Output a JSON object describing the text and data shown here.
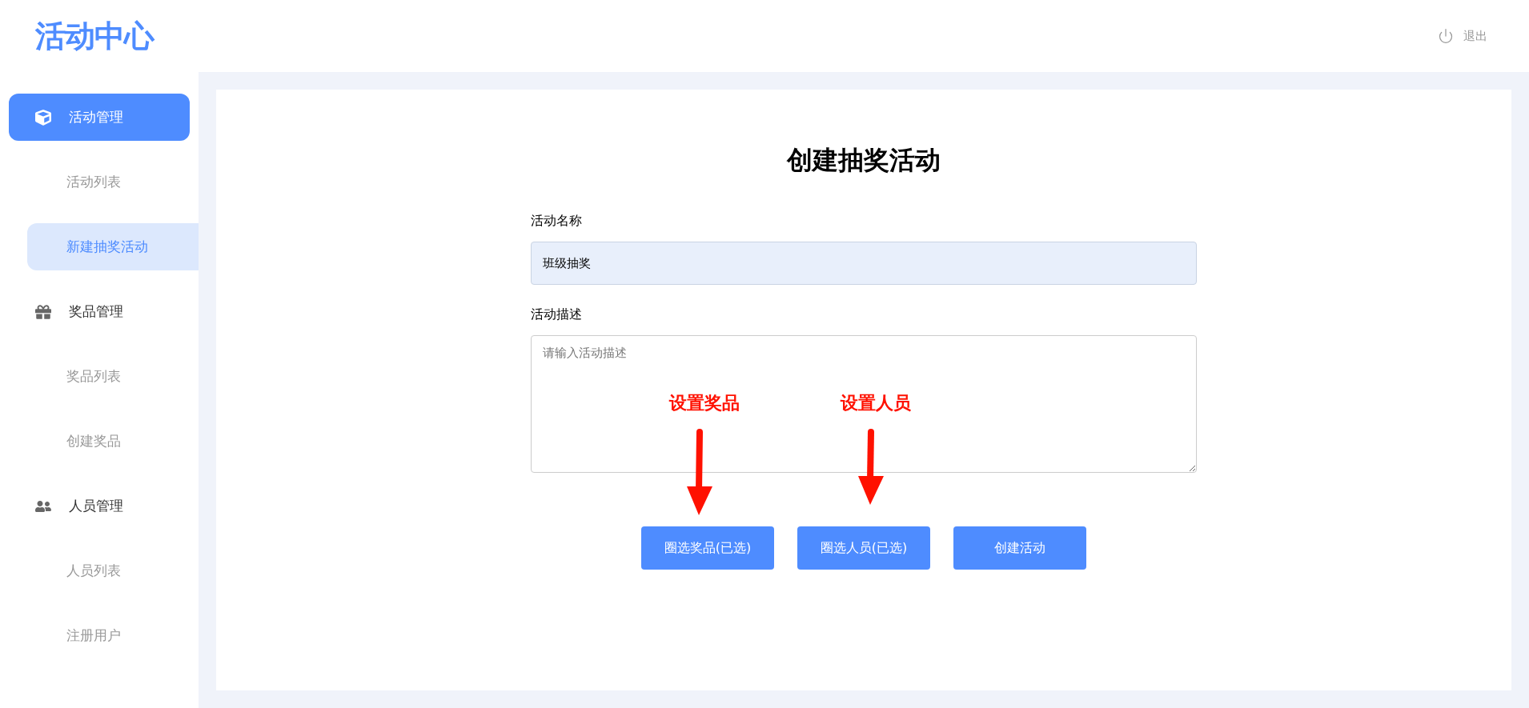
{
  "header": {
    "logo": "活动中心",
    "logout": "退出"
  },
  "sidebar": {
    "groups": [
      {
        "label": "活动管理",
        "selected": true,
        "children": [
          {
            "label": "活动列表",
            "selected": false
          },
          {
            "label": "新建抽奖活动",
            "selected": true
          }
        ]
      },
      {
        "label": "奖品管理",
        "selected": false,
        "children": [
          {
            "label": "奖品列表",
            "selected": false
          },
          {
            "label": "创建奖品",
            "selected": false
          }
        ]
      },
      {
        "label": "人员管理",
        "selected": false,
        "children": [
          {
            "label": "人员列表",
            "selected": false
          },
          {
            "label": "注册用户",
            "selected": false
          }
        ]
      }
    ]
  },
  "form": {
    "title": "创建抽奖活动",
    "fields": [
      {
        "kind": "input",
        "label": "活动名称",
        "value": "班级抽奖"
      },
      {
        "kind": "textarea",
        "label": "活动描述",
        "placeholder": "请输入活动描述"
      }
    ],
    "buttons": [
      "圈选奖品(已选)",
      "圈选人员(已选)",
      "创建活动"
    ]
  },
  "annotations": [
    {
      "text": "设置奖品"
    },
    {
      "text": "设置人员"
    }
  ]
}
